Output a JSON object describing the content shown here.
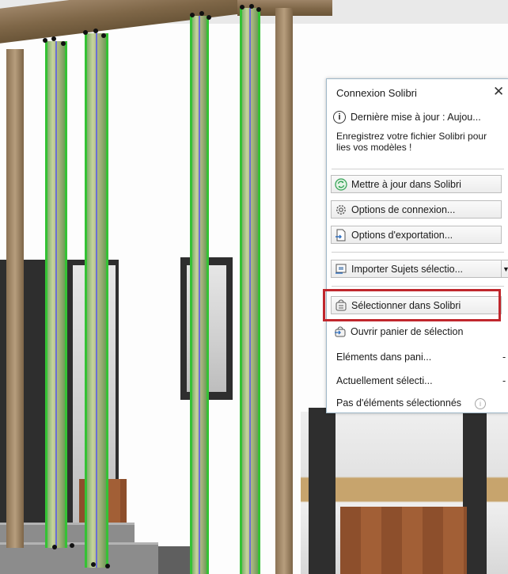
{
  "palette": {
    "title": "Connexion Solibri",
    "close_glyph": "✕",
    "last_update": "Dernière mise à jour : Aujou...",
    "register_text": "Enregistrez votre fichier Solibri pour lies vos modèles !",
    "buttons": {
      "update": "Mettre à jour dans Solibri",
      "connection_options": "Options de connexion...",
      "export_options": "Options d'exportation...",
      "import_subjects": "Importer Sujets sélectio...",
      "select_in_solibri": "Sélectionner dans Solibri",
      "open_basket": "Ouvrir panier de sélection"
    },
    "rows": {
      "basket_elements": "Eléments dans pani...",
      "currently_selected": "Actuellement sélecti...",
      "no_selection": "Pas d'éléments sélectionnés",
      "dash": "-"
    },
    "colors": {
      "highlight": "#c0272d",
      "selection_green": "#35c235",
      "update_icon_green": "#3aa55a"
    }
  }
}
